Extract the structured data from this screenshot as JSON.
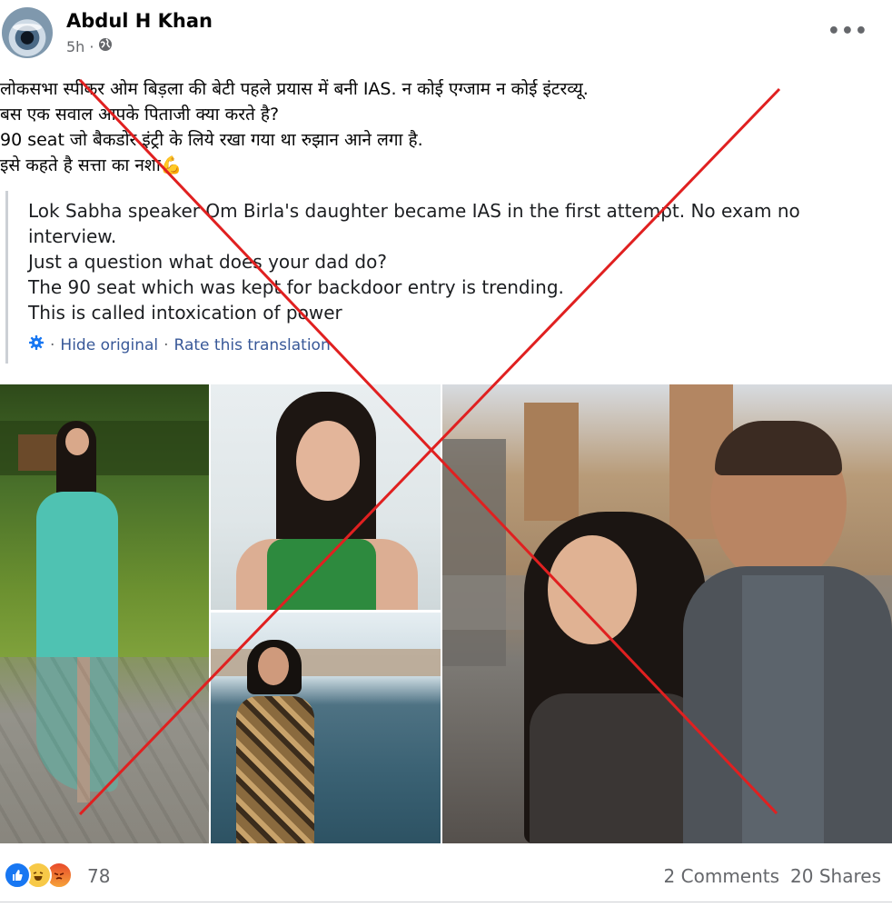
{
  "post": {
    "author": "Abdul H Khan",
    "time": "5h",
    "audience_icon": "globe-icon",
    "more_icon": "ellipsis-icon",
    "more_label": "•••",
    "hindi_lines": [
      "लोकसभा स्पीकर ओम बिड़ला की बेटी पहले प्रयास में बनी IAS. न कोई एग्जाम न कोई इंटरव्यू.",
      "बस एक सवाल आपके पिताजी क्या करते है?",
      "90 seat जो बैकडोर इंट्री के लिये रखा गया था रुझान आने लगा है.",
      "इसे कहते है सत्ता का नशा💪"
    ],
    "translation_lines": [
      "Lok Sabha speaker Om Birla's daughter became IAS in the first attempt. No exam no",
      "interview.",
      "Just a question what does your dad do?",
      "The 90 seat which was kept for backdoor entry is trending.",
      "This is called intoxication of power"
    ],
    "translation_controls": {
      "icon": "gear-icon",
      "hide_original": "Hide original",
      "rate": "Rate this translation",
      "separator": "·"
    }
  },
  "engagement": {
    "reaction_icons": [
      "like-icon",
      "haha-icon",
      "angry-icon"
    ],
    "reaction_count": "78",
    "comments": "2 Comments",
    "shares": "20 Shares"
  },
  "colors": {
    "link": "#385898",
    "secondary_text": "#65676b",
    "like_blue": "#1877f2",
    "cross_red": "#e02020"
  }
}
